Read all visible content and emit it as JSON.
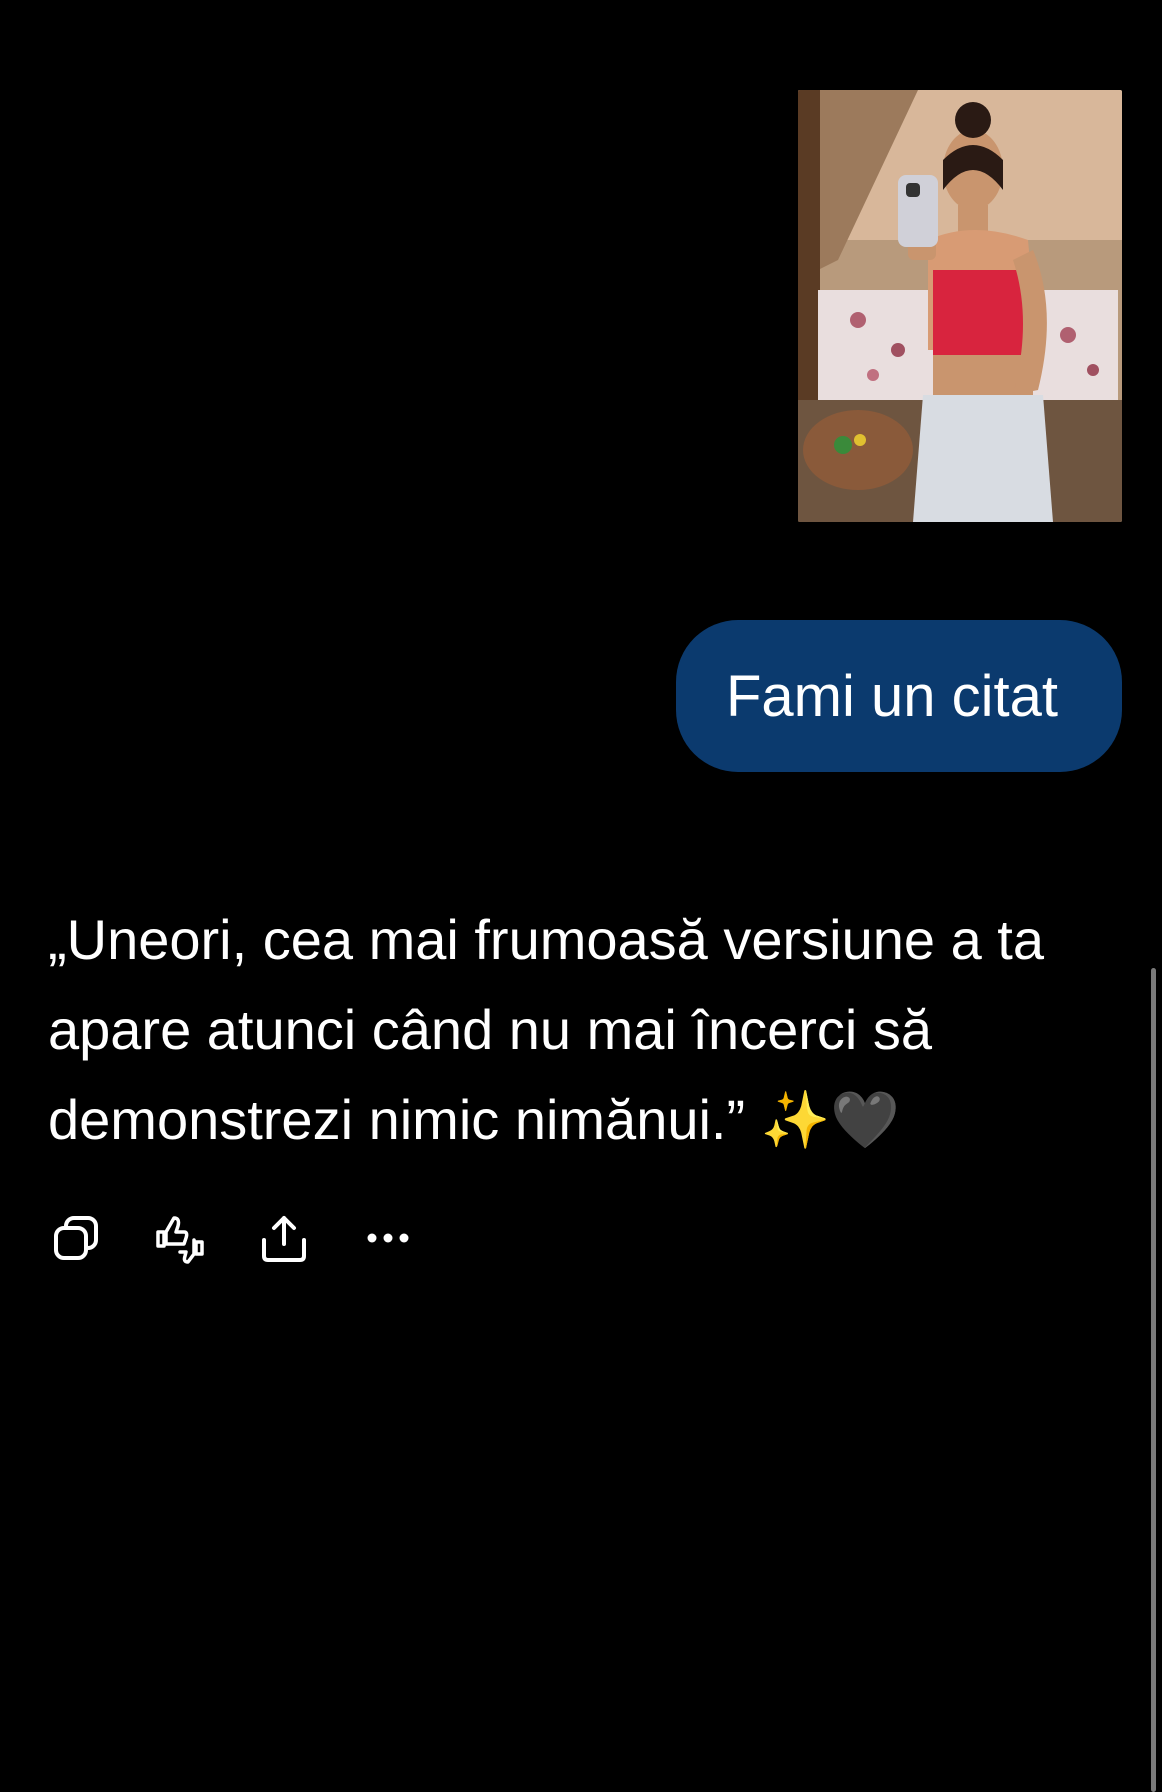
{
  "user_message": {
    "attachment_icon": "photo-thumbnail",
    "text": "Fami un citat",
    "bubble_color": "#0b3a6e"
  },
  "assistant_message": {
    "text": "„Uneori, cea mai frumoasă versiune a ta apare atunci când nu mai încerci să demonstrezi nimic nimănui.” ✨🖤"
  },
  "actions": [
    {
      "icon": "copy-icon"
    },
    {
      "icon": "thumbs-up-down-icon"
    },
    {
      "icon": "share-icon"
    },
    {
      "icon": "more-icon"
    }
  ],
  "colors": {
    "background": "#000000",
    "text": "#ffffff",
    "icon": "#ffffff"
  }
}
